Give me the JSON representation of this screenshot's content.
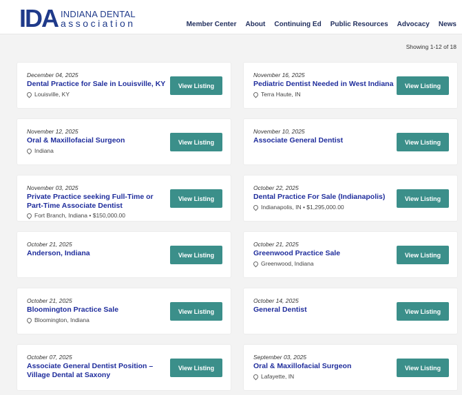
{
  "header": {
    "logo_mark": "IDA",
    "logo_line1": "INDIANA DENTAL",
    "logo_line2": "association",
    "nav": [
      "Member Center",
      "About",
      "Continuing Ed",
      "Public Resources",
      "Advocacy",
      "News"
    ]
  },
  "results": {
    "showing": "Showing 1-12 of 18"
  },
  "button_label": "View Listing",
  "listings": [
    {
      "date": "December 04, 2025",
      "title": "Dental Practice for Sale in Louisville, KY",
      "location": "Louisville, KY"
    },
    {
      "date": "November 16, 2025",
      "title": "Pediatric Dentist Needed in West Indiana",
      "location": "Terra Haute, IN"
    },
    {
      "date": "November 12, 2025",
      "title": "Oral & Maxillofacial Surgeon",
      "location": "Indiana"
    },
    {
      "date": "November 10, 2025",
      "title": "Associate General Dentist",
      "location": ""
    },
    {
      "date": "November 03, 2025",
      "title": "Private Practice seeking Full-Time or Part-Time Associate Dentist",
      "location": "Fort Branch, Indiana • $150,000.00"
    },
    {
      "date": "October 22, 2025",
      "title": "Dental Practice For Sale (Indianapolis)",
      "location": "Indianapolis, IN • $1,295,000.00"
    },
    {
      "date": "October 21, 2025",
      "title": "Anderson, Indiana",
      "location": ""
    },
    {
      "date": "October 21, 2025",
      "title": "Greenwood Practice Sale",
      "location": "Greenwood, Indiana"
    },
    {
      "date": "October 21, 2025",
      "title": "Bloomington Practice Sale",
      "location": "Bloomington, Indiana"
    },
    {
      "date": "October 14, 2025",
      "title": "General Dentist",
      "location": ""
    },
    {
      "date": "October 07, 2025",
      "title": "Associate General Dentist Position – Village Dental at Saxony",
      "location": ""
    },
    {
      "date": "September 03, 2025",
      "title": "Oral & Maxillofacial Surgeon",
      "location": "Lafayette, IN"
    }
  ],
  "colors": {
    "brand": "#1f3a8a",
    "button": "#3b8f8a",
    "title": "#1f2d9c"
  }
}
